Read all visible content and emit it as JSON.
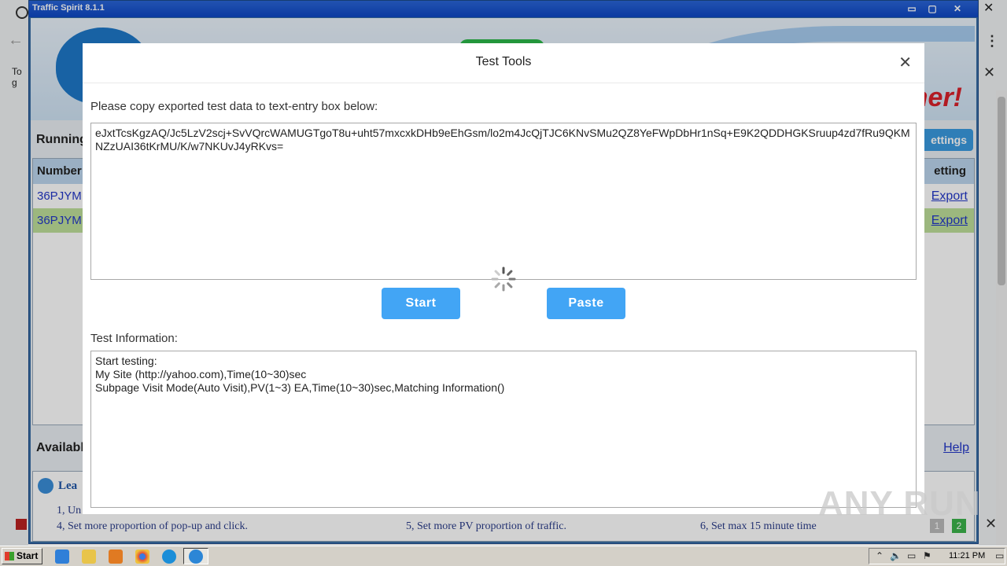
{
  "app": {
    "title": "Traffic Spirit 8.1.1",
    "window_buttons": {
      "minimize": "▭",
      "restore": "▢",
      "close": "✕"
    },
    "slogan": "her!",
    "running_label": "Running",
    "settings_label": "ettings",
    "grid": {
      "col_number": "Number",
      "col_setting": "etting",
      "rows": [
        {
          "number": "36PJYM",
          "action": "Export"
        },
        {
          "number": "36PJYM",
          "action": "Export"
        }
      ]
    },
    "available_label": "Availabl",
    "help_label": "Help",
    "learn_title": "Lea",
    "tips": {
      "t1": "1, Un",
      "t4": "4, Set more proportion of pop-up and click.",
      "t5": "5, Set more PV proportion of traffic.",
      "t6": "6, Set max 15 minute time"
    },
    "pages": [
      "1",
      "2"
    ]
  },
  "browser": {
    "togo_text": "To g"
  },
  "modal": {
    "title": "Test Tools",
    "close_glyph": "✕",
    "copy_prompt": "Please copy exported test data to text-entry box below:",
    "test_data": "eJxtTcsKgzAQ/Jc5LzV2scj+SvVQrcWAMUGTgoT8u+uht57mxcxkDHb9eEhGsm/lo2m4JcQjTJC6KNvSMu2QZ8YeFWpDbHr1nSq+E9K2QDDHGKSruup4zd7fRu9QKMNZzUAI36tKrMU/K/w7NKUvJ4yRKvs=",
    "start_label": "Start",
    "paste_label": "Paste",
    "info_label": "Test Information:",
    "info_lines": [
      "Start testing:",
      "My Site (http://yahoo.com),Time(10~30)sec",
      "Subpage Visit Mode(Auto Visit),PV(1~3) EA,Time(10~30)sec,Matching Information()"
    ],
    "accent_color": "#42a5f5"
  },
  "watermark": "ANY RUN",
  "taskbar": {
    "start_label": "Start",
    "clock": "11:21 PM",
    "icons": [
      "ie-icon",
      "folder-icon",
      "media-player-icon",
      "chrome-icon",
      "edge-icon",
      "traffic-spirit-icon"
    ]
  }
}
